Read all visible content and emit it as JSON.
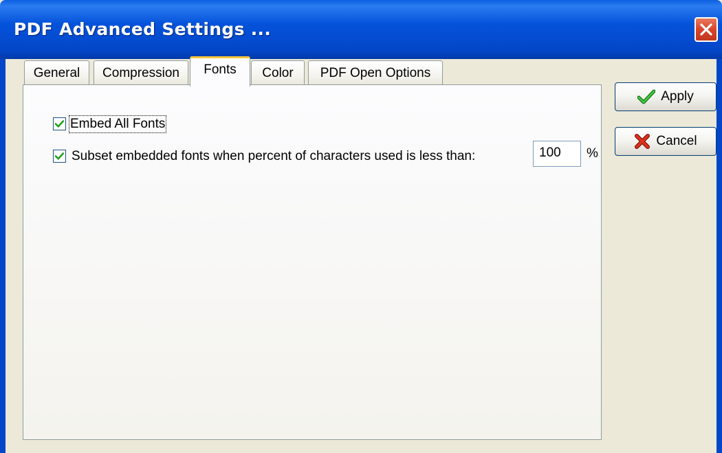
{
  "window": {
    "title": "PDF Advanced Settings ..."
  },
  "tabs": [
    {
      "label": "General",
      "active": false
    },
    {
      "label": "Compression",
      "active": false
    },
    {
      "label": "Fonts",
      "active": true
    },
    {
      "label": "Color",
      "active": false
    },
    {
      "label": "PDF Open Options",
      "active": false
    }
  ],
  "fonts": {
    "embed_all": {
      "label": "Embed All Fonts",
      "checked": true
    },
    "subset": {
      "label": "Subset embedded fonts when percent of characters used is less than:",
      "checked": true,
      "value": "100",
      "unit": "%"
    }
  },
  "buttons": {
    "apply": "Apply",
    "cancel": "Cancel"
  },
  "colors": {
    "titlebar": "#0553db",
    "tab_highlight": "#ffc83c",
    "checkmark": "#21a121",
    "cancel_x": "#d22a1a"
  },
  "icons": {
    "close": "close-icon",
    "apply": "checkmark-icon",
    "cancel": "x-icon"
  }
}
